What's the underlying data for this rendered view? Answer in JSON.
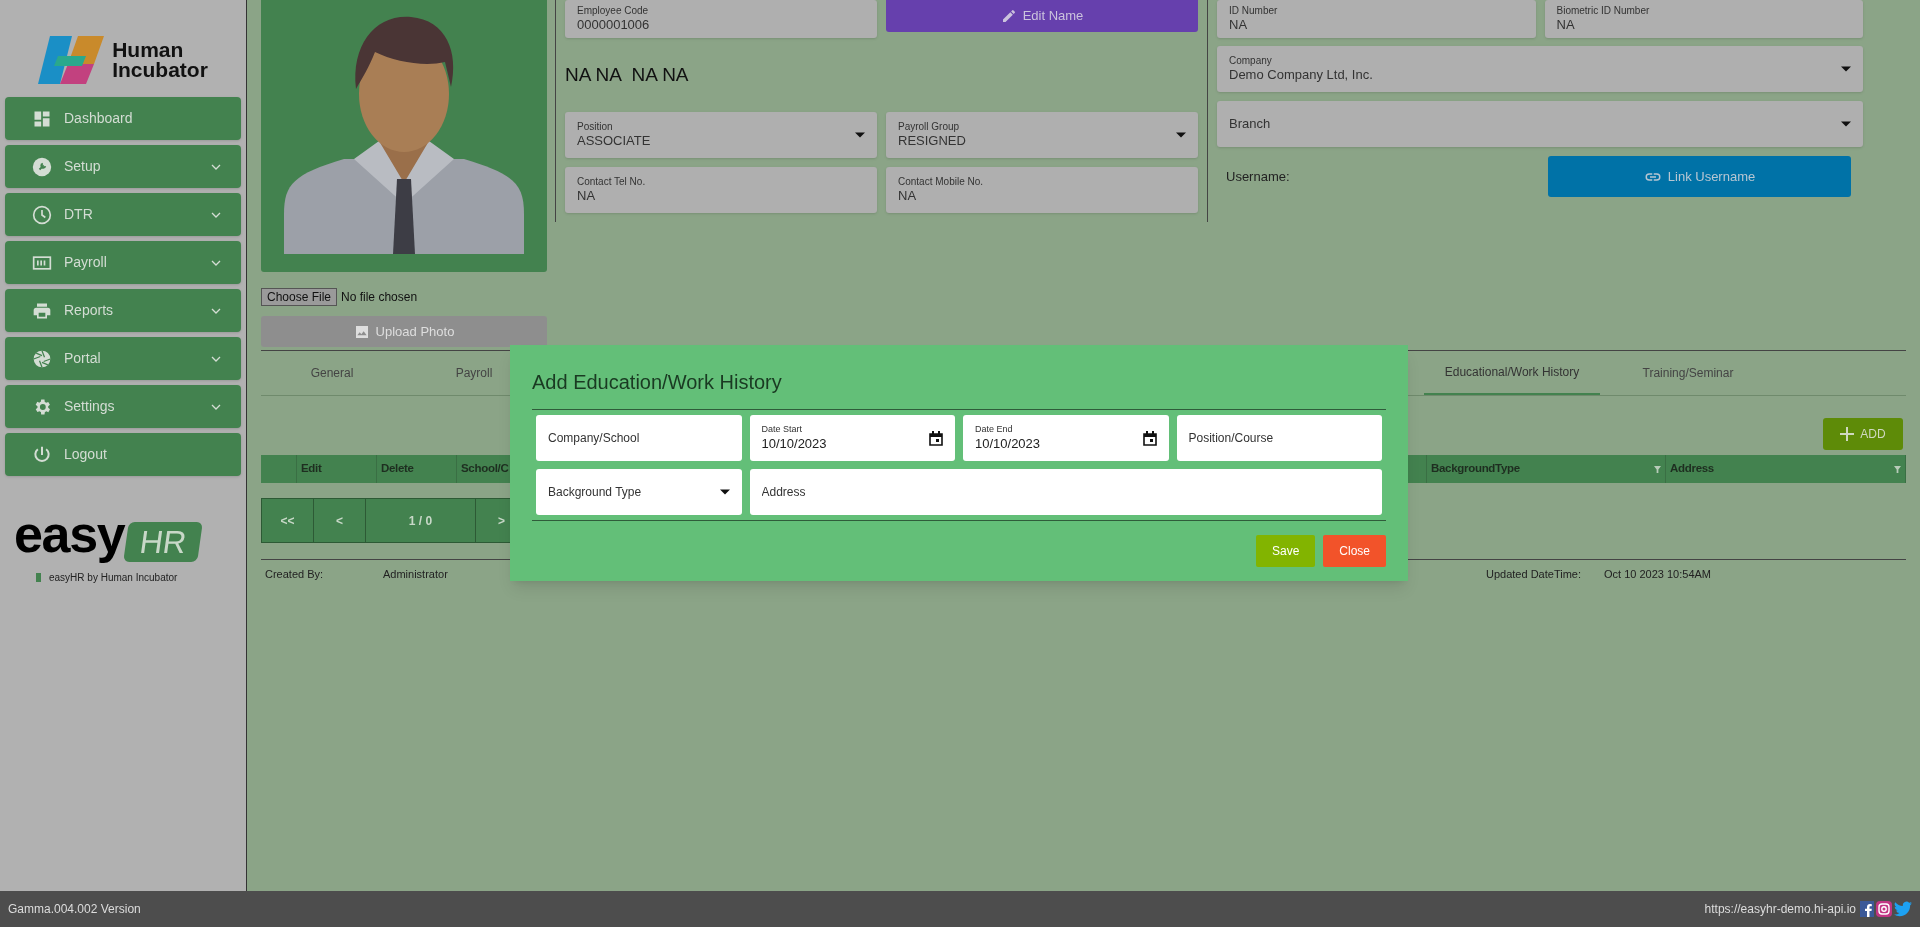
{
  "sidebar": {
    "logo": {
      "line_1": "Human",
      "line_2": "Incubator"
    },
    "items": [
      {
        "label": "Dashboard",
        "kind": "dashboard",
        "expandable": false
      },
      {
        "label": "Setup",
        "kind": "setup",
        "expandable": true
      },
      {
        "label": "DTR",
        "kind": "dtr",
        "expandable": true
      },
      {
        "label": "Payroll",
        "kind": "payroll",
        "expandable": true
      },
      {
        "label": "Reports",
        "kind": "reports",
        "expandable": true
      },
      {
        "label": "Portal",
        "kind": "portal",
        "expandable": true
      },
      {
        "label": "Settings",
        "kind": "settings",
        "expandable": true
      },
      {
        "label": "Logout",
        "kind": "logout",
        "expandable": false
      }
    ],
    "brand": {
      "word": "easy",
      "badge": "HR",
      "caption": "easyHR by Human Incubator"
    }
  },
  "photo": {
    "file_button": "Choose File",
    "file_status": "No file chosen",
    "upload_button": "Upload Photo",
    "upload_disabled": true
  },
  "middle": {
    "fields_top": [
      {
        "kind": "text",
        "label": "Employee Code",
        "value": "0000001006"
      }
    ],
    "edit_button": "Edit Name",
    "full_name": "NA NA  NA NA",
    "fields": [
      {
        "kind": "select",
        "label": "Position",
        "value": "ASSOCIATE"
      },
      {
        "kind": "select",
        "label": "Payroll Group",
        "value": "RESIGNED"
      },
      {
        "kind": "text",
        "label": "Contact Tel No.",
        "value": "NA"
      },
      {
        "kind": "text",
        "label": "Contact Mobile No.",
        "value": "NA"
      }
    ]
  },
  "right": {
    "fields": [
      {
        "kind": "text",
        "label": "ID Number",
        "value": "NA"
      },
      {
        "kind": "text",
        "label": "Biometric ID Number",
        "value": "NA"
      }
    ],
    "wide_fields": [
      {
        "kind": "select",
        "label": "Company",
        "value": "Demo Company Ltd, Inc."
      },
      {
        "kind": "select",
        "label": "Branch"
      }
    ],
    "username_label": "Username:",
    "link_button": "Link Username"
  },
  "tabs": [
    {
      "label": "General",
      "selected": false
    },
    {
      "label": "Payroll",
      "selected": false
    },
    {
      "label": "Educational/Work History",
      "selected": true
    },
    {
      "label": "Training/Seminar",
      "selected": false
    }
  ],
  "add_button": "ADD",
  "table": {
    "columns": [
      {
        "filter": false
      },
      {
        "label": "Edit",
        "filter": false
      },
      {
        "label": "Delete",
        "filter": false
      },
      {
        "label": "School/C",
        "filter": false
      },
      {
        "label": "BackgroundType",
        "filter": true
      },
      {
        "label": "Address",
        "filter": true
      }
    ]
  },
  "pager": [
    "<<",
    "<",
    "1 / 0",
    ">"
  ],
  "audit": [
    {
      "label": "Created By:",
      "value": "Administrator"
    },
    {
      "label": "Updated DateTime:",
      "value": "Oct 10 2023 10:54AM"
    }
  ],
  "modal": {
    "title": "Add Education/Work History",
    "rows": [
      [
        {
          "kind": "text",
          "placeholder": "Company/School"
        },
        {
          "kind": "date",
          "label": "Date Start",
          "value": "10/10/2023"
        },
        {
          "kind": "date",
          "label": "Date End",
          "value": "10/10/2023"
        },
        {
          "kind": "text",
          "placeholder": "Position/Course"
        }
      ],
      [
        {
          "kind": "select",
          "placeholder": "Background Type"
        },
        {
          "kind": "text",
          "placeholder": "Address"
        }
      ]
    ],
    "buttons": [
      {
        "kind": "save",
        "label": "Save"
      },
      {
        "kind": "close",
        "label": "Close"
      }
    ]
  },
  "status_bar": {
    "version": "Gamma.004.002 Version",
    "url": "https://easyhr-demo.hi-api.io"
  }
}
